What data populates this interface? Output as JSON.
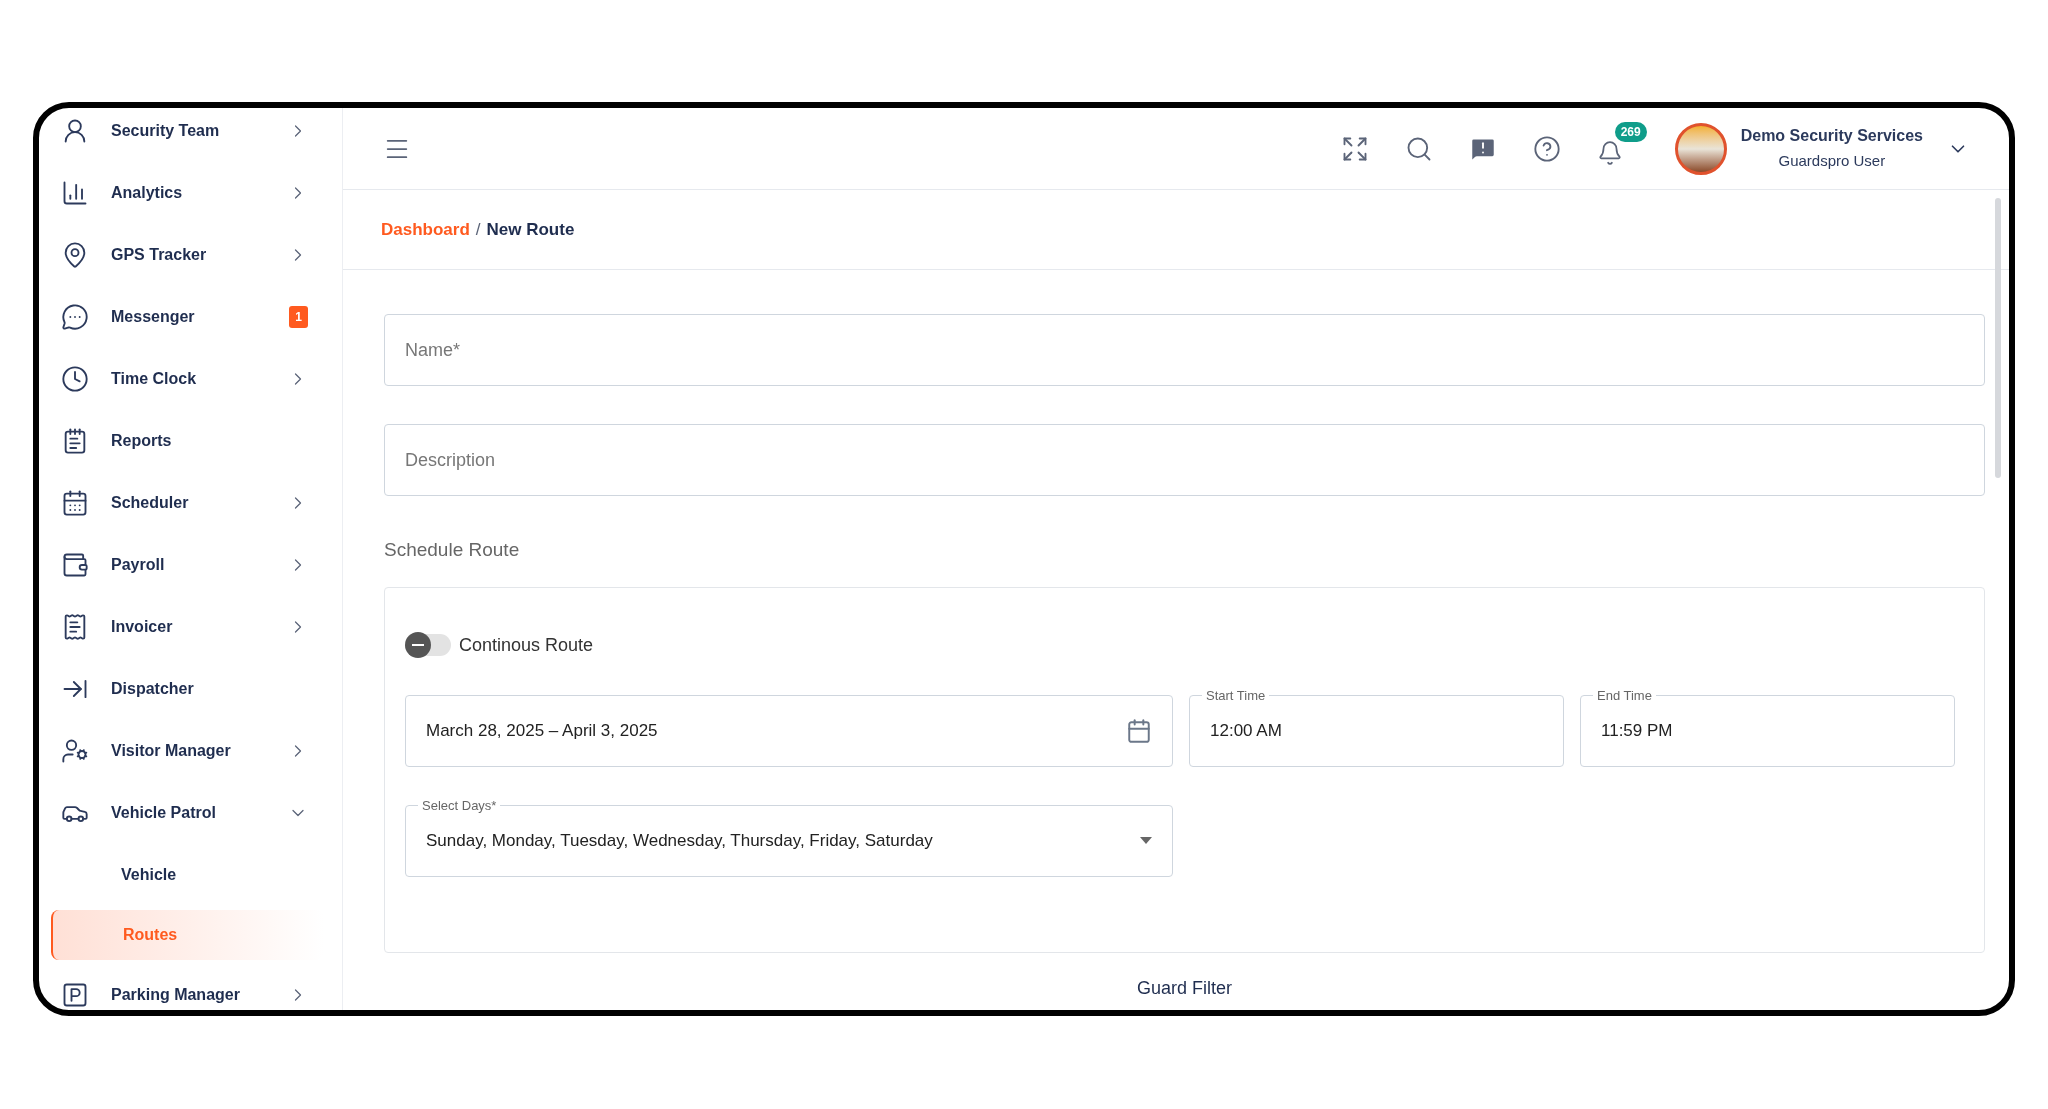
{
  "sidebar": {
    "items": [
      {
        "label": "Security Team",
        "expanded": false
      },
      {
        "label": "Analytics",
        "expanded": false
      },
      {
        "label": "GPS Tracker",
        "expanded": false
      },
      {
        "label": "Messenger",
        "badge": "1"
      },
      {
        "label": "Time Clock",
        "expanded": false
      },
      {
        "label": "Reports"
      },
      {
        "label": "Scheduler",
        "expanded": false
      },
      {
        "label": "Payroll",
        "expanded": false
      },
      {
        "label": "Invoicer",
        "expanded": false
      },
      {
        "label": "Dispatcher"
      },
      {
        "label": "Visitor Manager",
        "expanded": false
      },
      {
        "label": "Vehicle Patrol",
        "expanded": true,
        "children": [
          {
            "label": "Vehicle",
            "selected": false
          },
          {
            "label": "Routes",
            "selected": true
          }
        ]
      },
      {
        "label": "Parking Manager",
        "expanded": false
      }
    ]
  },
  "header": {
    "notifications": "269",
    "user": {
      "name": "Demo Security Services",
      "role": "Guardspro User"
    }
  },
  "breadcrumb": {
    "items": [
      "Dashboard",
      "New Route"
    ],
    "separator": "/"
  },
  "form": {
    "name": {
      "placeholder": "Name*"
    },
    "description": {
      "placeholder": "Description"
    },
    "schedule": {
      "title": "Schedule Route",
      "toggle": {
        "label": "Continous Route",
        "on": false
      },
      "date_range": {
        "value": "March 28, 2025 – April 3, 2025"
      },
      "start_time": {
        "label": "Start Time",
        "value": "12:00 AM"
      },
      "end_time": {
        "label": "End Time",
        "value": "11:59 PM"
      },
      "select_days": {
        "label": "Select Days*",
        "value": "Sunday, Monday, Tuesday, Wednesday, Thursday, Friday, Saturday"
      }
    },
    "next_section": "Guard Filter"
  }
}
